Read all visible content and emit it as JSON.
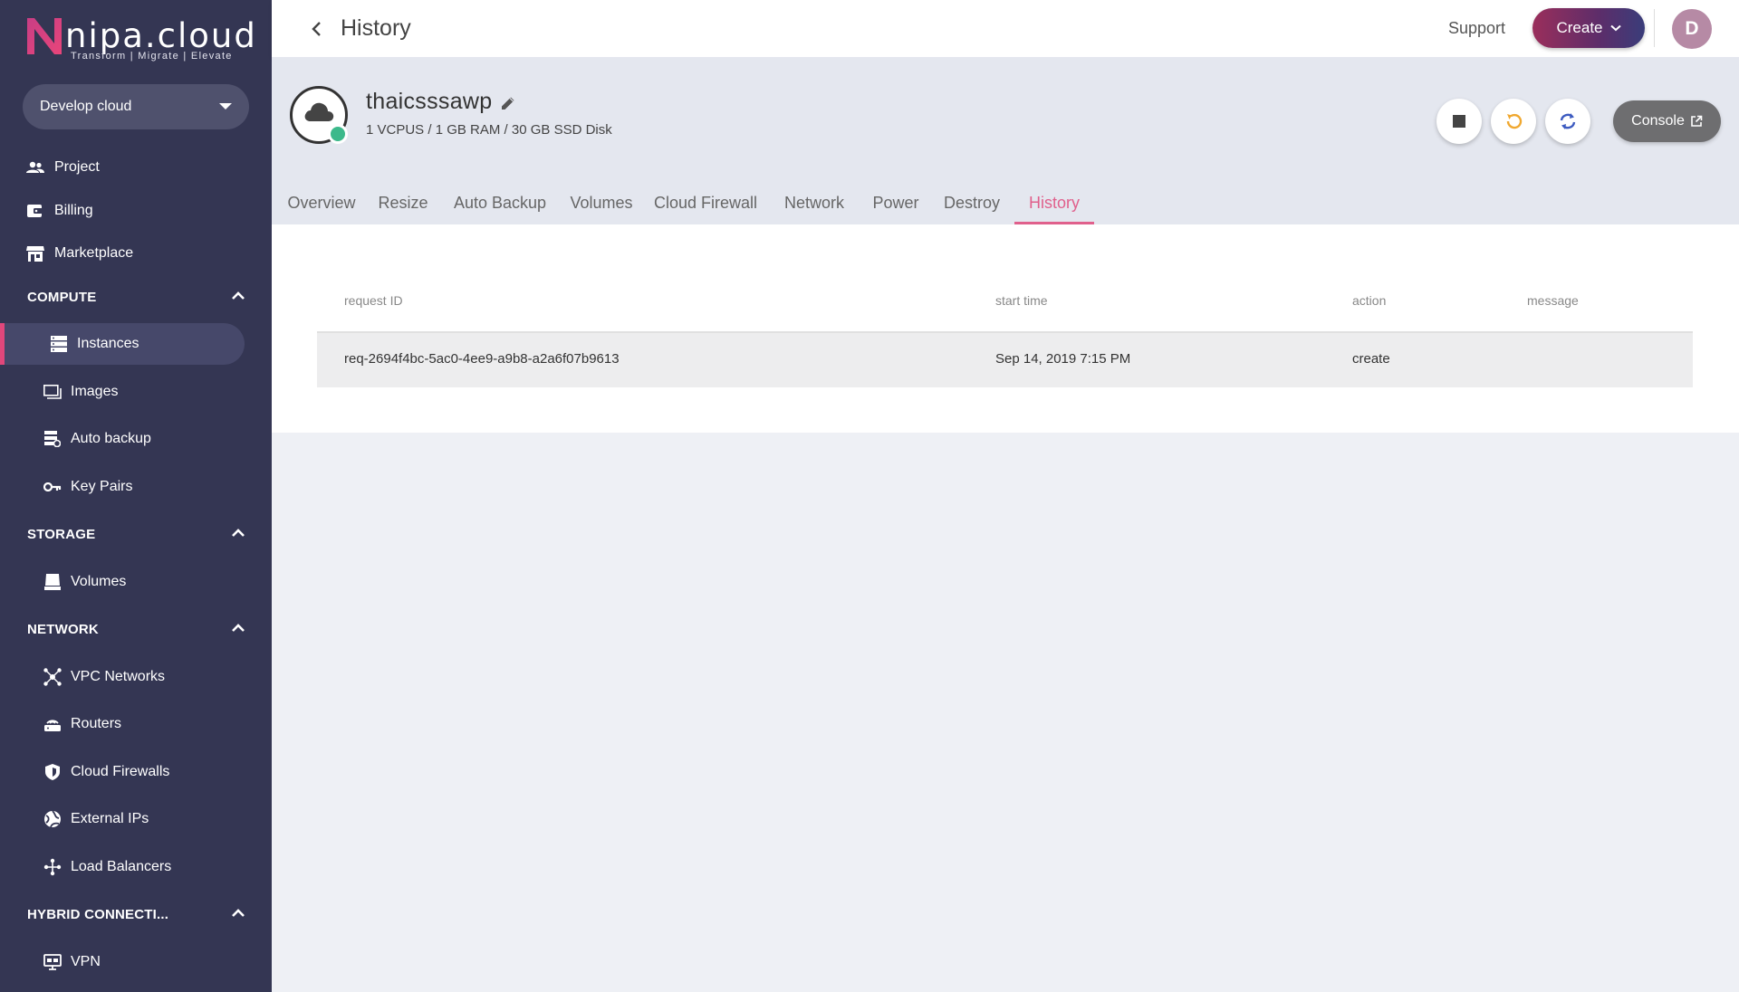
{
  "brand": {
    "name": "nipa.cloud",
    "tagline": "Transform  |  Migrate  |  Elevate"
  },
  "project_selector": {
    "value": "Develop cloud"
  },
  "sidebar": {
    "main": [
      {
        "label": "Project",
        "icon": "people-icon"
      },
      {
        "label": "Billing",
        "icon": "wallet-icon"
      },
      {
        "label": "Marketplace",
        "icon": "store-icon"
      }
    ],
    "sections": {
      "compute": {
        "title": "COMPUTE",
        "items": [
          {
            "label": "Instances",
            "icon": "server-icon",
            "active": true
          },
          {
            "label": "Images",
            "icon": "images-icon"
          },
          {
            "label": "Auto backup",
            "icon": "backup-icon"
          },
          {
            "label": "Key Pairs",
            "icon": "key-icon"
          }
        ]
      },
      "storage": {
        "title": "STORAGE",
        "items": [
          {
            "label": "Volumes",
            "icon": "disk-icon"
          }
        ]
      },
      "network": {
        "title": "NETWORK",
        "items": [
          {
            "label": "VPC Networks",
            "icon": "network-icon"
          },
          {
            "label": "Routers",
            "icon": "router-icon"
          },
          {
            "label": "Cloud Firewalls",
            "icon": "shield-icon"
          },
          {
            "label": "External IPs",
            "icon": "globe-icon"
          },
          {
            "label": "Load Balancers",
            "icon": "balancer-icon"
          }
        ]
      },
      "hybrid": {
        "title": "HYBRID CONNECTI...",
        "items": [
          {
            "label": "VPN",
            "icon": "vpn-icon"
          }
        ]
      }
    }
  },
  "header": {
    "title": "History",
    "support_label": "Support",
    "create_label": "Create",
    "avatar_initial": "D"
  },
  "instance": {
    "name": "thaicsssawp",
    "specs": "1 VCPUS / 1 GB RAM / 30 GB SSD Disk",
    "status_color": "#3cb98b",
    "console_label": "Console"
  },
  "tabs": [
    "Overview",
    "Resize",
    "Auto Backup",
    "Volumes",
    "Cloud Firewall",
    "Network",
    "Power",
    "Destroy",
    "History"
  ],
  "active_tab": "History",
  "history_table": {
    "columns": {
      "request_id": "request ID",
      "start_time": "start time",
      "action": "action",
      "message": "message"
    },
    "rows": [
      {
        "request_id": "req-2694f4bc-5ac0-4ee9-a9b8-a2a6f07b9613",
        "start_time": "Sep 14, 2019 7:15 PM",
        "action": "create",
        "message": ""
      }
    ]
  },
  "colors": {
    "sidebar": "#343653",
    "accent": "#e0477b",
    "tab_active": "#e0608c"
  }
}
